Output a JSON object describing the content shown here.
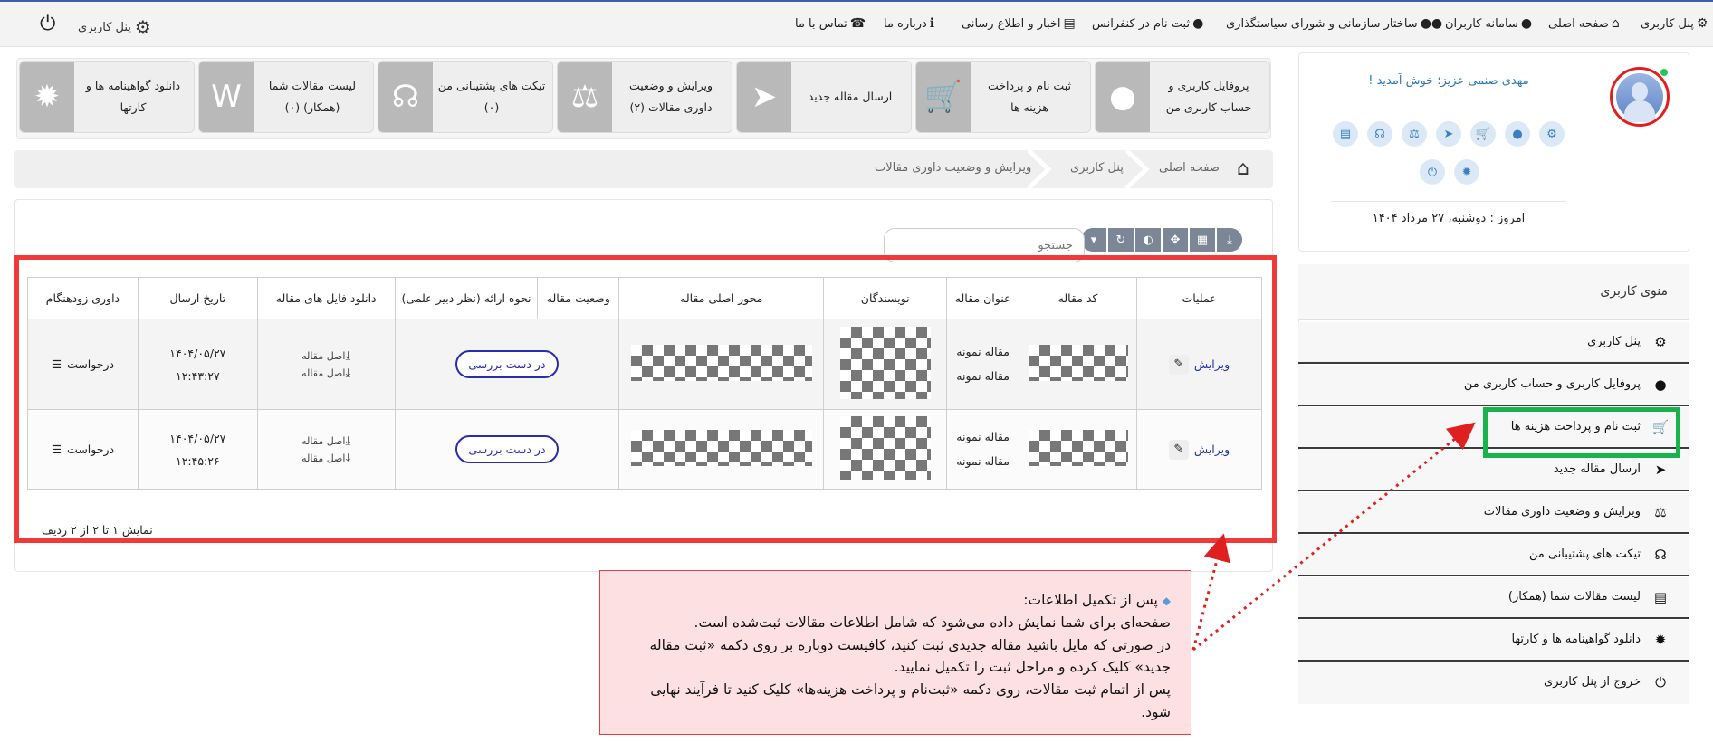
{
  "topnav": {
    "items": [
      {
        "label": "پنل کاربری",
        "icon": "gear-icon"
      },
      {
        "label": "صفحه اصلی",
        "icon": "home-icon"
      },
      {
        "label": "سامانه کاربران",
        "icon": "user-icon"
      },
      {
        "label": "ساختار سازمانی و شورای سیاستگذاری",
        "icon": "users-icon"
      },
      {
        "label": "ثبت نام در کنفرانس",
        "icon": "user-icon"
      },
      {
        "label": "اخبار و اطلاع رسانی",
        "icon": "newspaper-icon"
      },
      {
        "label": "درباره ما",
        "icon": "info-icon"
      },
      {
        "label": "تماس با ما",
        "icon": "phone-icon"
      }
    ],
    "panel_label": "پنل کاربری"
  },
  "tiles": [
    {
      "label": "پروفایل کاربری و حساب کاربری من",
      "icon": "user-icon"
    },
    {
      "label": "ثبت نام و پرداخت هزینه ها",
      "icon": "cart-icon"
    },
    {
      "label": "ارسال مقاله جدید",
      "icon": "paper-plane-icon"
    },
    {
      "label": "ویرایش و وضعیت داوری مقالات (۲)",
      "icon": "scale-icon"
    },
    {
      "label": "تیکت های پشتیبانی من (۰)",
      "icon": "headset-icon"
    },
    {
      "label": "لیست مقالات شما (همکار) (۰)",
      "icon": "word-file-icon"
    },
    {
      "label": "دانلود گواهینامه ها و کارتها",
      "icon": "certificate-icon"
    }
  ],
  "breadcrumb": {
    "home": "صفحه اصلی",
    "panel": "پنل کاربری",
    "current": "ویرایش و وضعیت داوری مقالات"
  },
  "search": {
    "placeholder": "جستجو"
  },
  "table": {
    "headers": [
      "عملیات",
      "کد مقاله",
      "عنوان مقاله",
      "نویسندگان",
      "محور اصلی مقاله",
      "وضعیت مقاله",
      "نحوه ارائه (نظر دبیر علمی)",
      "دانلود فایل های مقاله",
      "تاریخ ارسال",
      "داوری زودهنگام"
    ],
    "rows": [
      {
        "edit": "ویرایش",
        "title1": "مقاله نمونه",
        "title2": "مقاله نمونه",
        "status": "در دست بررسی",
        "dl1": "اصل مقاله",
        "dl2": "اصل مقاله",
        "date": "۱۴۰۴/۰۵/۲۷",
        "time": "۱۲:۴۳:۲۷",
        "request": "درخواست"
      },
      {
        "edit": "ویرایش",
        "title1": "مقاله نمونه",
        "title2": "مقاله نمونه",
        "status": "در دست بررسی",
        "dl1": "اصل مقاله",
        "dl2": "اصل مقاله",
        "date": "۱۴۰۴/۰۵/۲۷",
        "time": "۱۲:۴۵:۲۶",
        "request": "درخواست"
      }
    ],
    "footer": "نمایش ۱ تا ۲ از ۲ ردیف"
  },
  "profile": {
    "welcome": "مهدی صنمی عزیز؛ خوش آمدید !",
    "today": "امروز : دوشنبه، ۲۷ مرداد ۱۴۰۴"
  },
  "menu": {
    "title": "منوی کاربری",
    "items": [
      {
        "label": "پنل کاربری",
        "icon": "gear-icon"
      },
      {
        "label": "پروفایل کاربری و حساب کاربری من",
        "icon": "user-icon"
      },
      {
        "label": "ثبت نام و پرداخت هزینه ها",
        "icon": "cart-icon"
      },
      {
        "label": "ارسال مقاله جدید",
        "icon": "paper-plane-icon"
      },
      {
        "label": "ویرایش و وضعیت داوری مقالات",
        "icon": "scale-icon"
      },
      {
        "label": "تیکت های پشتیبانی من",
        "icon": "headset-icon"
      },
      {
        "label": "لیست مقالات شما (همکار)",
        "icon": "word-file-icon"
      },
      {
        "label": "دانلود گواهینامه ها و کارتها",
        "icon": "certificate-icon"
      },
      {
        "label": "خروج از پنل کاربری",
        "icon": "power-icon"
      }
    ]
  },
  "tip": {
    "line1": "پس از تکمیل اطلاعات:",
    "line2": "صفحه‌ای برای شما نمایش داده می‌شود که شامل اطلاعات مقالات ثبت‌شده است.",
    "line3": "در صورتی که مایل باشید مقاله جدیدی ثبت کنید، کافیست دوباره بر روی دکمه «ثبت مقاله جدید» کلیک کرده و مراحل ثبت را تکمیل نمایید.",
    "line4": "پس از اتمام ثبت مقالات، روی دکمه «ثبت‌نام و پرداخت هزینه‌ها» کلیک کنید تا فرآیند نهایی شود."
  },
  "colors": {
    "highlight_red": "#f03a3a",
    "highlight_green": "#18b34a",
    "link_blue": "#2234a4",
    "status_blue": "#2b2bb0"
  }
}
